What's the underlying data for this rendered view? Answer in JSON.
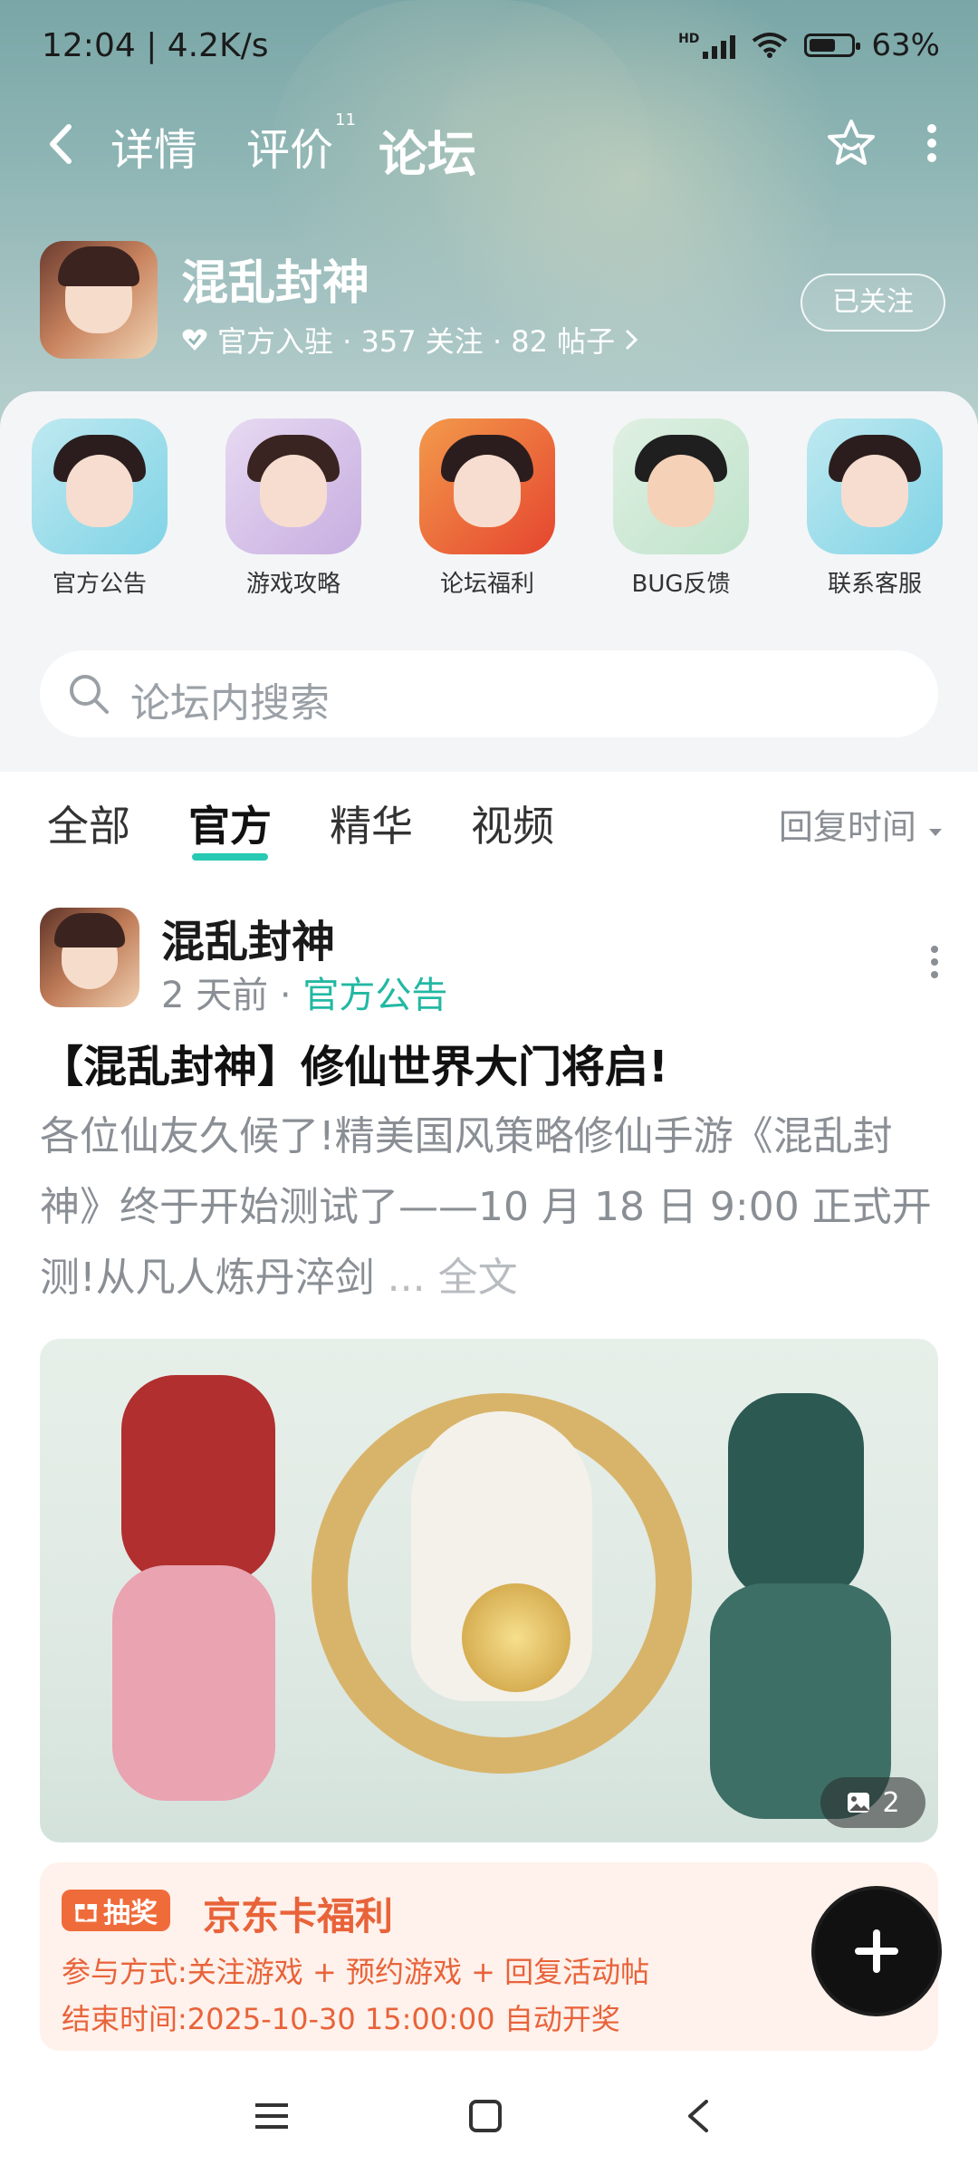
{
  "status_bar": {
    "time": "12:04 | 4.2K/s",
    "network": "HD",
    "battery": "63%",
    "battery_level": 0.63
  },
  "nav": {
    "tabs": [
      {
        "label": "详情"
      },
      {
        "label": "评价"
      },
      {
        "label": "论坛"
      }
    ],
    "review_count": "11",
    "active_tab": "论坛"
  },
  "game": {
    "name": "混乱封神",
    "stats": "官方入驻 · 357 关注 · 82 帖子",
    "follow_button": "已关注"
  },
  "shortcuts": [
    {
      "label": "官方公告"
    },
    {
      "label": "游戏攻略"
    },
    {
      "label": "论坛福利"
    },
    {
      "label": "BUG反馈"
    },
    {
      "label": "联系客服"
    }
  ],
  "search": {
    "placeholder": "论坛内搜索"
  },
  "filters": {
    "tabs": [
      {
        "label": "全部"
      },
      {
        "label": "官方"
      },
      {
        "label": "精华"
      },
      {
        "label": "视频"
      }
    ],
    "active": "官方",
    "sort_label": "回复时间"
  },
  "post": {
    "author": "混乱封神",
    "time": "2 天前",
    "category": "官方公告",
    "title": "【混乱封神】修仙世界大门将启!",
    "body": "各位仙友久候了!精美国风策略修仙手游《混乱封神》终于开始测试了——10 月 18 日 9:00 正式开测!从凡人炼丹淬剑",
    "ellipsis": "...",
    "full_text": "全文",
    "image_count": "2"
  },
  "lottery": {
    "badge": "抽奖",
    "title": "京东卡福利",
    "participate": "参与方式:关注游戏 + 预约游戏 + 回复活动帖",
    "end_time": "结束时间:2025-10-30 15:00:00 自动开奖"
  },
  "colors": {
    "accent": "#27c9b3",
    "category": "#23b8a3",
    "lottery": "#e8633a",
    "lottery_bg": "#fff1eb"
  }
}
